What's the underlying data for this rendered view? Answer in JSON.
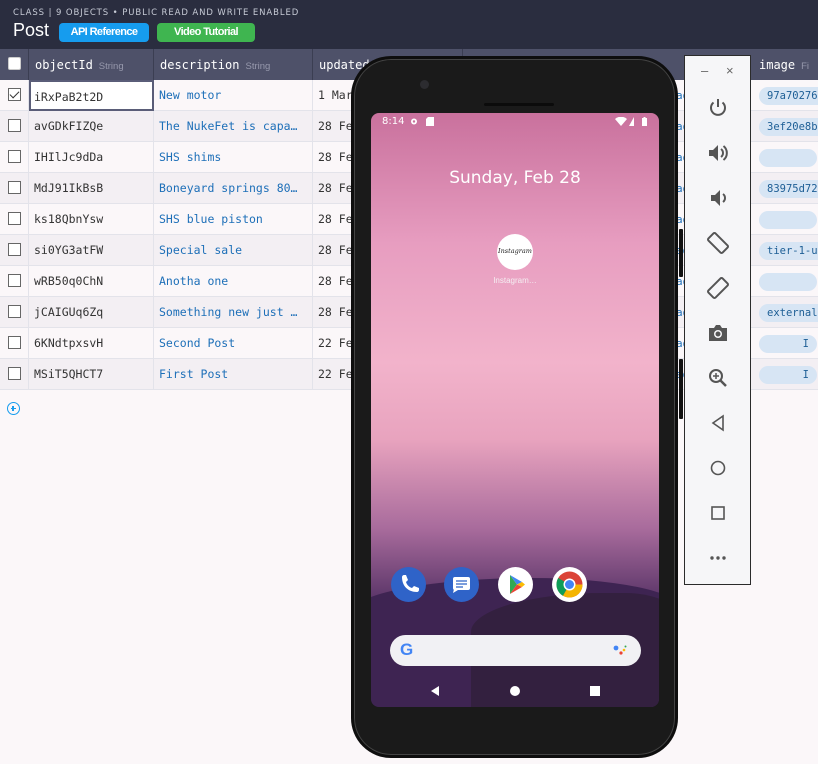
{
  "header": {
    "subtitle": "CLASS | 9 OBJECTS • PUBLIC READ AND WRITE ENABLED",
    "class_name": "Post",
    "api_reference_label": "API Reference",
    "video_tutorial_label": "Video Tutorial"
  },
  "columns": [
    {
      "name": "objectId",
      "type": "String"
    },
    {
      "name": "description",
      "type": "String"
    },
    {
      "name": "updated",
      "type": ""
    },
    {
      "name": "image",
      "type": "Fi"
    }
  ],
  "rows": [
    {
      "objectId": "iRxPaB2t2D",
      "description": "New motor",
      "updated": "1 Mar",
      "frag": "ad",
      "image": "97a70276",
      "checked": true,
      "selected": true
    },
    {
      "objectId": "avGDkFIZQe",
      "description": "The NukeFet is capa…",
      "updated": "28 Fe",
      "frag": "ad",
      "image": "3ef20e8b",
      "checked": false,
      "selected": false
    },
    {
      "objectId": "IHIlJc9dDa",
      "description": "SHS shims",
      "updated": "28 Fe",
      "frag": "ad",
      "image": "",
      "checked": false,
      "selected": false
    },
    {
      "objectId": "MdJ91IkBsB",
      "description": "Boneyard springs 80…",
      "updated": "28 Fe",
      "frag": "ad",
      "image": "83975d72",
      "checked": false,
      "selected": false
    },
    {
      "objectId": "ks18QbnYsw",
      "description": "SHS blue piston",
      "updated": "28 Fe",
      "frag": "ad",
      "image": "",
      "checked": false,
      "selected": false
    },
    {
      "objectId": "si0YG3atFW",
      "description": "Special sale",
      "updated": "28 Fe",
      "frag": "ad",
      "image": "tier-1-u",
      "checked": false,
      "selected": false
    },
    {
      "objectId": "wRB50q0ChN",
      "description": "Anotha one",
      "updated": "28 Fe",
      "frag": "ad",
      "image": "",
      "checked": false,
      "selected": false
    },
    {
      "objectId": "jCAIGUq6Zq",
      "description": "Something new just …",
      "updated": "28 Fe",
      "frag": "ad",
      "image": "external",
      "checked": false,
      "selected": false
    },
    {
      "objectId": "6KNdtpxsvH",
      "description": "Second Post",
      "updated": "22 Fe",
      "frag": "ad",
      "image": "I",
      "checked": false,
      "selected": false
    },
    {
      "objectId": "MSiT5QHCT7",
      "description": "First Post",
      "updated": "22 Fe",
      "frag": "ad",
      "image": "I",
      "checked": false,
      "selected": false
    }
  ],
  "emulator": {
    "minimize": "–",
    "close": "×",
    "tools": [
      "power-icon",
      "volume-up-icon",
      "volume-down-icon",
      "rotate-left-icon",
      "rotate-right-icon",
      "camera-icon",
      "zoom-icon",
      "back-icon",
      "home-icon",
      "overview-icon",
      "more-icon"
    ]
  },
  "phone": {
    "time": "8:14",
    "date": "Sunday, Feb 28",
    "app_icon_text": "Instagram",
    "app_label": "Instagram…",
    "search_logo": "G",
    "dock": [
      "phone-icon",
      "messages-icon",
      "play-store-icon",
      "chrome-icon"
    ]
  },
  "colors": {
    "header_bg": "#2a2d3f",
    "column_header_bg": "#4e5169",
    "api_button": "#169cee",
    "video_button": "#3fb550",
    "link_text": "#1d6fb8",
    "pill_bg": "#d7e5f4"
  }
}
